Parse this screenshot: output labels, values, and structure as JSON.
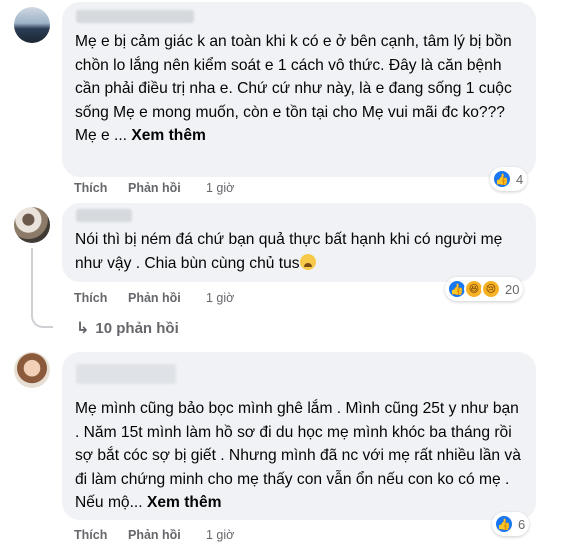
{
  "comments": [
    {
      "text": "Mẹ e bị cảm giác k an toàn khi k có e ở bên cạnh, tâm lý bị bồn chồn lo lắng nên kiểm soát e 1 cách vô thức. Đây là căn bệnh cần phải điều trị nha e. Chứ cứ như này, là e đang sống 1 cuộc sống Mẹ e mong muốn, còn e tồn tại cho Mẹ vui mãi đc ko??? Mẹ e ...",
      "see_more": "Xem thêm",
      "like_label": "Thích",
      "reply_label": "Phản hồi",
      "time": "1 giờ",
      "reaction_count": "4",
      "reaction_icons": [
        "like-icon"
      ]
    },
    {
      "text": "Nói thì bị ném đá chứ bạn quả thực bất hạnh khi có người mẹ như vậy . Chia bùn cùng chủ tus",
      "like_label": "Thích",
      "reply_label": "Phản hồi",
      "time": "1 giờ",
      "reaction_count": "20",
      "reaction_icons": [
        "like-icon",
        "haha-icon",
        "sad-icon"
      ],
      "replies_label": "10 phản hồi"
    },
    {
      "text": "Mẹ mình cũng bảo bọc mình ghê lắm . Mình cũng 25t y như bạn . Năm 15t mình làm hồ sơ đi du học mẹ mình khóc ba tháng rồi sợ bắt cóc sợ bị giết . Nhưng mình đã nc với mẹ rất nhiều lần và đi làm chứng minh cho mẹ thấy con vẫn ổn nếu con ko có mẹ . Nếu mộ...",
      "see_more": "Xem thêm",
      "like_label": "Thích",
      "reply_label": "Phản hồi",
      "time": "1 giờ",
      "reaction_count": "6",
      "reaction_icons": [
        "like-icon"
      ]
    }
  ],
  "colors": {
    "bubble": "#f0f2f5",
    "secondary_text": "#65676b",
    "like_blue": "#1877f2",
    "haha_yellow": "#f7b125"
  }
}
